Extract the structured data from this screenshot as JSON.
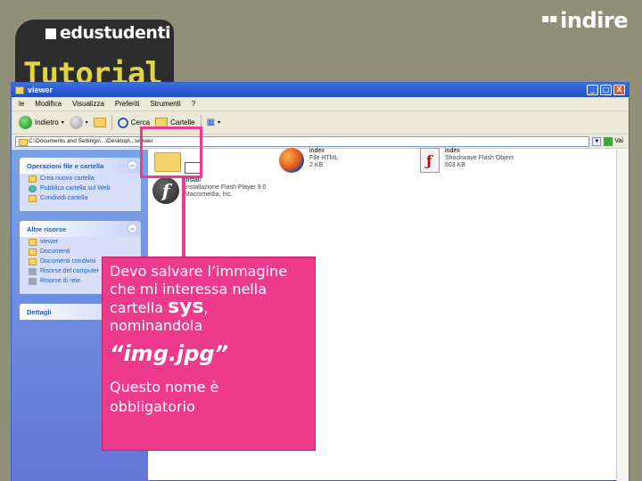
{
  "logo": {
    "brand": "edustudenti",
    "tutorial": "Tutorial"
  },
  "indice_logo": "indire",
  "window": {
    "title": "viewer",
    "buttons": [
      "_",
      "□",
      "X"
    ],
    "menu": [
      "le",
      "Modifica",
      "Visualizza",
      "Preferiti",
      "Strumenti",
      "?"
    ],
    "toolbar": {
      "back": "Indietro",
      "search": "Cerca",
      "folders": "Cartelle"
    },
    "address": "C:\\Documents and Settings\\...\\Desktop\\...\\viewer",
    "go": "Vai"
  },
  "panels": {
    "tasks": {
      "title": "Operazioni file e cartella",
      "items": [
        "Crea nuova cartella",
        "Pubblica cartella sul Web",
        "Condividi cartella"
      ]
    },
    "places": {
      "title": "Altre risorse",
      "items": [
        "viewer",
        "Documenti",
        "Documenti condivisi",
        "Risorse del computer",
        "Risorse di rete"
      ]
    },
    "details": {
      "title": "Dettagli"
    }
  },
  "files": {
    "index_html": {
      "name": "index",
      "type": "File HTML",
      "size": "2 KB"
    },
    "index_swf": {
      "name": "index",
      "type": "Shockwave Flash Object",
      "size": "603 KB"
    },
    "player": {
      "name": "install",
      "type": "Installazione Flash Player 9.0",
      "company": "Macromedia, Inc."
    },
    "sys_label": "sys"
  },
  "callout": {
    "line1": "Devo salvare l’immagine",
    "line2": "che mi interessa nella",
    "line3a": "cartella ",
    "line3b": "sys",
    "line3c": ",",
    "line4": "nominandola",
    "line5": "“img.jpg”",
    "line6": "Questo nome è",
    "line7": "obbligatorio"
  },
  "colors": {
    "accent": "#ee3a8c",
    "logo_yellow": "#e0d54a",
    "background": "#8f9077"
  }
}
